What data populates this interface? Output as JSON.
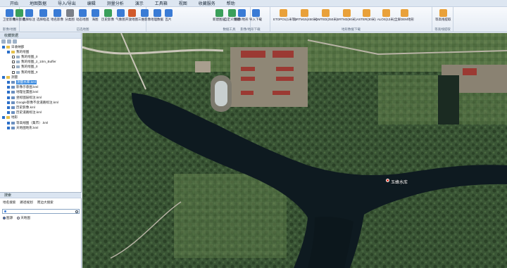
{
  "menu": [
    "开始",
    "地图数据",
    "导入/导出",
    "编辑",
    "测量分析",
    "演示",
    "工具箱",
    "视图",
    "收藏服务",
    "帮助"
  ],
  "ribbon": {
    "groups": [
      {
        "label": "影像/地图"
      },
      {
        "label": "已选地图"
      },
      {
        "label": "数据工具"
      },
      {
        "label": "影像/地形下载"
      },
      {
        "label": "地形数据下载"
      },
      {
        "label": "等高线提取"
      }
    ],
    "buttons": [
      {
        "label": "卫星影像",
        "color": "#3a7bd5"
      },
      {
        "label": "地形影像",
        "color": "#3a9f5a"
      },
      {
        "label": "选择标注",
        "color": "#3a7bd5"
      },
      {
        "label": "选择框选",
        "color": "#3a7bd5"
      },
      {
        "label": "地名影像",
        "color": "#3a7bd5"
      },
      {
        "label": "分类图",
        "color": "#7a7f88"
      },
      {
        "label": "动态地图",
        "color": "#3a7bd5"
      },
      {
        "label": "海图",
        "color": "#3a7bd5"
      },
      {
        "label": "历史影像",
        "color": "#3a9f5a"
      },
      {
        "label": "气象图",
        "color": "#3a7bd5"
      },
      {
        "label": "开放地图",
        "color": "#d25a2b"
      },
      {
        "label": "三维影像",
        "color": "#3a7bd5"
      },
      {
        "label": "地理数据",
        "color": "#3a7bd5"
      },
      {
        "label": "瓦片",
        "color": "#3a7bd5"
      },
      {
        "label": "新建图层",
        "color": "#3a9f5a"
      },
      {
        "label": "自定义数据",
        "color": "#3a9f5a"
      },
      {
        "label": "影像/地形",
        "color": "#3a7bd5"
      },
      {
        "label": "导入下载",
        "color": "#3a7bd5"
      },
      {
        "label": "ETOPO1(1米等)",
        "color": "#e9a13a"
      },
      {
        "label": "SRTM15(450米)",
        "color": "#e9a13a"
      },
      {
        "label": "GMTED(250米)",
        "color": "#e9a13a"
      },
      {
        "label": "SRTM3(90米)",
        "color": "#e9a13a"
      },
      {
        "label": "ASTER(30米)",
        "color": "#e9a13a"
      },
      {
        "label": "ALOS(12米)",
        "color": "#e9a13a"
      },
      {
        "label": "全屏DEM地形",
        "color": "#e9a13a"
      },
      {
        "label": "等高线提取",
        "color": "#e9a13a"
      }
    ]
  },
  "sidebar": {
    "title": "收藏数据",
    "tree": [
      {
        "label": "日收纳部",
        "level": 0,
        "kind": "folder",
        "checked": true
      },
      {
        "label": "我的绘图",
        "level": 1,
        "kind": "folder",
        "checked": true
      },
      {
        "label": "我的绘图_0",
        "level": 2,
        "kind": "shp",
        "checked": false
      },
      {
        "label": "我的绘图_2_10m_Buffer",
        "level": 2,
        "kind": "shp",
        "checked": false
      },
      {
        "label": "我的绘图_0",
        "level": 2,
        "kind": "shp",
        "checked": false
      },
      {
        "label": "我的绘图_0",
        "level": 2,
        "kind": "shp",
        "checked": false
      },
      {
        "label": "测量",
        "level": 0,
        "kind": "folder",
        "checked": true
      },
      {
        "label": "测量水库.kml",
        "level": 1,
        "kind": "kml",
        "checked": true,
        "selected": true
      },
      {
        "label": "影像示意图.kml",
        "level": 1,
        "kind": "kml",
        "checked": true
      },
      {
        "label": "地理位置图.kml",
        "level": 1,
        "kind": "kml",
        "checked": true
      },
      {
        "label": "坐标图层标注.kml",
        "level": 1,
        "kind": "kml",
        "checked": true
      },
      {
        "label": "Google影像不含道路标注.kml",
        "level": 1,
        "kind": "kml",
        "checked": true
      },
      {
        "label": "历史影像.kml",
        "level": 1,
        "kind": "kml",
        "checked": true
      },
      {
        "label": "历史道路标注.kml",
        "level": 1,
        "kind": "kml",
        "checked": true
      },
      {
        "label": "地形",
        "level": 0,
        "kind": "folder",
        "checked": true
      },
      {
        "label": "等高线图（集市）.kml",
        "level": 1,
        "kind": "kml",
        "checked": true
      },
      {
        "label": "天地图地形.kml",
        "level": 1,
        "kind": "kml",
        "checked": true
      }
    ]
  },
  "search": {
    "title": "搜索",
    "tabs": [
      "地名搜索",
      "路径规划",
      "周边大搜索"
    ],
    "placeholder": "",
    "options": [
      "图源",
      "天地图"
    ]
  },
  "map": {
    "label": "玉蜂水库",
    "colors": {
      "water": "#0e1a20",
      "forest": "#2f4a2c",
      "field": "#5b7a4a",
      "urban": "#9a8f7e",
      "roof": "#9b3a33"
    }
  }
}
